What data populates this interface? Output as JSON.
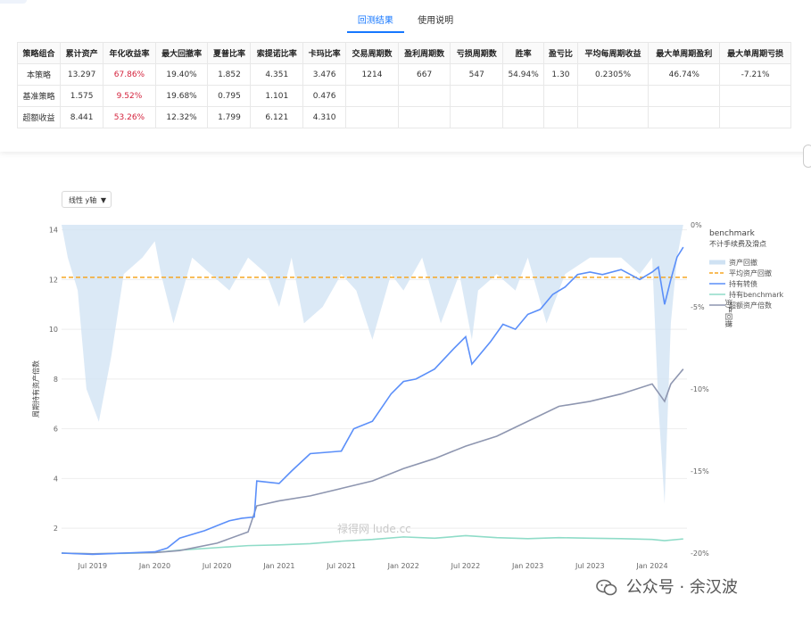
{
  "tabs": [
    {
      "label": "回测结果",
      "active": true
    },
    {
      "label": "使用说明",
      "active": false
    }
  ],
  "stats_table": {
    "headers": [
      "策略组合",
      "累计资产",
      "年化收益率",
      "最大回撤率",
      "夏普比率",
      "索提诺比率",
      "卡玛比率",
      "交易周期数",
      "盈利周期数",
      "亏损周期数",
      "胜率",
      "盈亏比",
      "平均每周期收益",
      "最大单周期盈利",
      "最大单周期亏损"
    ],
    "rows": [
      [
        "本策略",
        "13.297",
        "67.86%",
        "19.40%",
        "1.852",
        "4.351",
        "3.476",
        "1214",
        "667",
        "547",
        "54.94%",
        "1.30",
        "0.2305%",
        "46.74%",
        "-7.21%"
      ],
      [
        "基准策略",
        "1.575",
        "9.52%",
        "19.68%",
        "0.795",
        "1.101",
        "0.476",
        "",
        "",
        "",
        "",
        "",
        "",
        "",
        ""
      ],
      [
        "超额收益",
        "8.441",
        "53.26%",
        "12.32%",
        "1.799",
        "6.121",
        "4.310",
        "",
        "",
        "",
        "",
        "",
        "",
        "",
        ""
      ]
    ],
    "red_column": 2
  },
  "yscale_select": {
    "label": "线性 y轴",
    "caret": "▼"
  },
  "chart_data": {
    "type": "line",
    "ylabel_left": "周期持有资产倍数",
    "ylabel_right": "资产回撤",
    "left_ticks": [
      "2",
      "4",
      "6",
      "8",
      "10",
      "12",
      "14"
    ],
    "right_ticks": [
      "0%",
      "-5%",
      "-10%",
      "-15%",
      "-20%"
    ],
    "x_ticks": [
      "Jul 2019",
      "Jan 2020",
      "Jul 2020",
      "Jan 2021",
      "Jul 2021",
      "Jan 2022",
      "Jul 2022",
      "Jan 2023",
      "Jul 2023",
      "Jan 2024"
    ],
    "ylim_left": [
      1,
      14.2
    ],
    "ylim_right": [
      -20,
      0
    ],
    "legend_title": "benchmark",
    "legend_subtitle": "不计手续费及滑点",
    "legend": [
      "资产回撤",
      "平均资产回撤",
      "持有转债",
      "持有benchmark",
      "超额资产倍数"
    ],
    "avg_drawdown_pct": -3.2,
    "colors": {
      "drawdown": "#cfe2f3",
      "avg": "#f5a623",
      "strategy": "#5b8ff9",
      "benchmark": "#8fdcc8",
      "excess": "#8e96b0"
    },
    "series": [
      {
        "name": "持有转债",
        "x": [
          2019.25,
          2019.5,
          2019.75,
          2020.0,
          2020.1,
          2020.2,
          2020.4,
          2020.55,
          2020.6,
          2020.7,
          2020.8,
          2020.82,
          2021.0,
          2021.1,
          2021.25,
          2021.5,
          2021.6,
          2021.75,
          2021.9,
          2022.0,
          2022.1,
          2022.25,
          2022.4,
          2022.5,
          2022.55,
          2022.7,
          2022.8,
          2022.9,
          2023.0,
          2023.1,
          2023.2,
          2023.3,
          2023.4,
          2023.5,
          2023.6,
          2023.75,
          2023.9,
          2024.0,
          2024.05,
          2024.1,
          2024.15,
          2024.2,
          2024.25
        ],
        "values": [
          1.0,
          0.95,
          1.0,
          1.05,
          1.2,
          1.6,
          1.9,
          2.2,
          2.3,
          2.4,
          2.45,
          3.9,
          3.8,
          4.3,
          5.0,
          5.1,
          6.0,
          6.3,
          7.4,
          7.9,
          8.0,
          8.4,
          9.2,
          9.7,
          8.6,
          9.5,
          10.2,
          10.0,
          10.6,
          10.8,
          11.4,
          11.7,
          12.2,
          12.3,
          12.2,
          12.4,
          12.0,
          12.3,
          12.5,
          11.0,
          12.0,
          12.9,
          13.3
        ]
      },
      {
        "name": "持有benchmark",
        "x": [
          2019.25,
          2019.5,
          2019.75,
          2020.0,
          2020.2,
          2020.5,
          2020.75,
          2021.0,
          2021.25,
          2021.5,
          2021.75,
          2022.0,
          2022.25,
          2022.5,
          2022.75,
          2023.0,
          2023.25,
          2023.5,
          2023.75,
          2024.0,
          2024.1,
          2024.25
        ],
        "values": [
          1.0,
          0.97,
          0.99,
          1.02,
          1.12,
          1.22,
          1.3,
          1.33,
          1.38,
          1.48,
          1.55,
          1.65,
          1.6,
          1.7,
          1.62,
          1.58,
          1.62,
          1.6,
          1.58,
          1.55,
          1.5,
          1.57
        ]
      },
      {
        "name": "超额资产倍数",
        "x": [
          2019.25,
          2019.5,
          2019.75,
          2020.0,
          2020.2,
          2020.5,
          2020.75,
          2020.82,
          2021.0,
          2021.25,
          2021.5,
          2021.75,
          2022.0,
          2022.25,
          2022.5,
          2022.75,
          2023.0,
          2023.25,
          2023.5,
          2023.75,
          2024.0,
          2024.1,
          2024.15,
          2024.25
        ],
        "values": [
          1.0,
          0.97,
          1.0,
          1.02,
          1.1,
          1.4,
          1.85,
          2.9,
          3.1,
          3.3,
          3.6,
          3.9,
          4.4,
          4.8,
          5.3,
          5.7,
          6.3,
          6.9,
          7.1,
          7.4,
          7.8,
          7.1,
          7.8,
          8.4
        ]
      },
      {
        "name": "资产回撤",
        "x": [
          2019.25,
          2019.3,
          2019.38,
          2019.45,
          2019.55,
          2019.65,
          2019.75,
          2019.9,
          2020.0,
          2020.05,
          2020.15,
          2020.3,
          2020.45,
          2020.6,
          2020.75,
          2020.9,
          2021.0,
          2021.1,
          2021.2,
          2021.35,
          2021.5,
          2021.62,
          2021.75,
          2021.9,
          2022.0,
          2022.15,
          2022.3,
          2022.45,
          2022.55,
          2022.6,
          2022.75,
          2022.9,
          2023.0,
          2023.15,
          2023.3,
          2023.5,
          2023.6,
          2023.75,
          2023.9,
          2024.0,
          2024.05,
          2024.1,
          2024.15,
          2024.2,
          2024.25
        ],
        "values": [
          0,
          -2,
          -4,
          -10,
          -12,
          -8,
          -3,
          -2,
          -1,
          -3,
          -6,
          -2,
          -3,
          -4,
          -2,
          -3,
          -5,
          -2,
          -6,
          -5,
          -3,
          -4,
          -7,
          -3,
          -4,
          -2,
          -6,
          -3,
          -7,
          -4,
          -3,
          -4,
          -2,
          -6,
          -3,
          -2,
          -2,
          -2,
          -3,
          -2,
          -11,
          -17,
          -6,
          -2,
          0
        ]
      }
    ]
  },
  "watermark": {
    "site": "禄得网 lude.cc",
    "brand": "公众号 · 余汉波"
  }
}
